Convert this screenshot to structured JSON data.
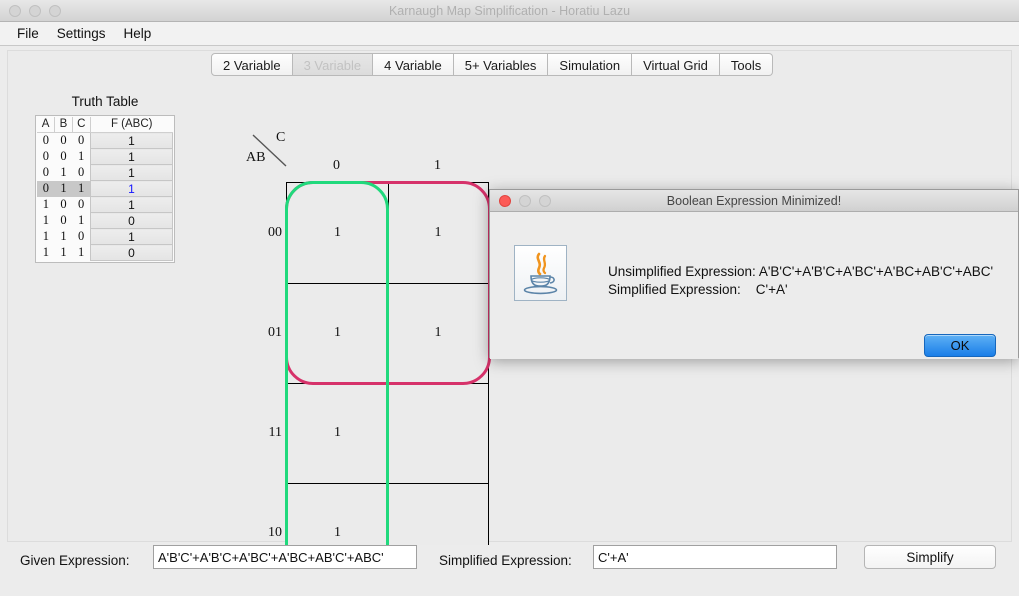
{
  "window": {
    "title": "Karnaugh Map Simplification - Horatiu Lazu",
    "menus": [
      "File",
      "Settings",
      "Help"
    ]
  },
  "tabs": [
    {
      "label": "2 Variable",
      "active": false
    },
    {
      "label": "3 Variable",
      "active": true
    },
    {
      "label": "4 Variable",
      "active": false
    },
    {
      "label": "5+ Variables",
      "active": false
    },
    {
      "label": "Simulation",
      "active": false
    },
    {
      "label": "Virtual Grid",
      "active": false
    },
    {
      "label": "Tools",
      "active": false
    }
  ],
  "truth_table": {
    "title": "Truth Table",
    "headers": [
      "A",
      "B",
      "C",
      "F (ABC)"
    ],
    "rows": [
      {
        "a": "0",
        "b": "0",
        "c": "0",
        "f": "1",
        "selected": false
      },
      {
        "a": "0",
        "b": "0",
        "c": "1",
        "f": "1",
        "selected": false
      },
      {
        "a": "0",
        "b": "1",
        "c": "0",
        "f": "1",
        "selected": false
      },
      {
        "a": "0",
        "b": "1",
        "c": "1",
        "f": "1",
        "selected": true
      },
      {
        "a": "1",
        "b": "0",
        "c": "0",
        "f": "1",
        "selected": false
      },
      {
        "a": "1",
        "b": "0",
        "c": "1",
        "f": "0",
        "selected": false
      },
      {
        "a": "1",
        "b": "1",
        "c": "0",
        "f": "1",
        "selected": false
      },
      {
        "a": "1",
        "b": "1",
        "c": "1",
        "f": "0",
        "selected": false
      }
    ]
  },
  "kmap": {
    "col_var": "C",
    "row_var": "AB",
    "col_headers": [
      "0",
      "1"
    ],
    "row_headers": [
      "00",
      "01",
      "11",
      "10"
    ],
    "cells": [
      [
        "1",
        "1"
      ],
      [
        "1",
        "1"
      ],
      [
        "1",
        ""
      ],
      [
        "1",
        ""
      ]
    ],
    "groups": [
      {
        "name": "group-a-prime",
        "color": "#d6326a"
      },
      {
        "name": "group-c-prime",
        "color": "#20d97c"
      }
    ]
  },
  "bottom_bar": {
    "given_label": "Given Expression:",
    "given_value": "A'B'C'+A'B'C+A'BC'+A'BC+AB'C'+ABC'",
    "simplified_label": "Simplified Expression:",
    "simplified_value": "C'+A'",
    "simplify_button": "Simplify"
  },
  "dialog": {
    "title": "Boolean Expression Minimized!",
    "icon": "java-coffee-cup-icon",
    "line1": "Unsimplified Expression: A'B'C'+A'B'C+A'BC'+A'BC+AB'C'+ABC'",
    "line2": "Simplified Expression:    C'+A'",
    "ok_label": "OK"
  }
}
